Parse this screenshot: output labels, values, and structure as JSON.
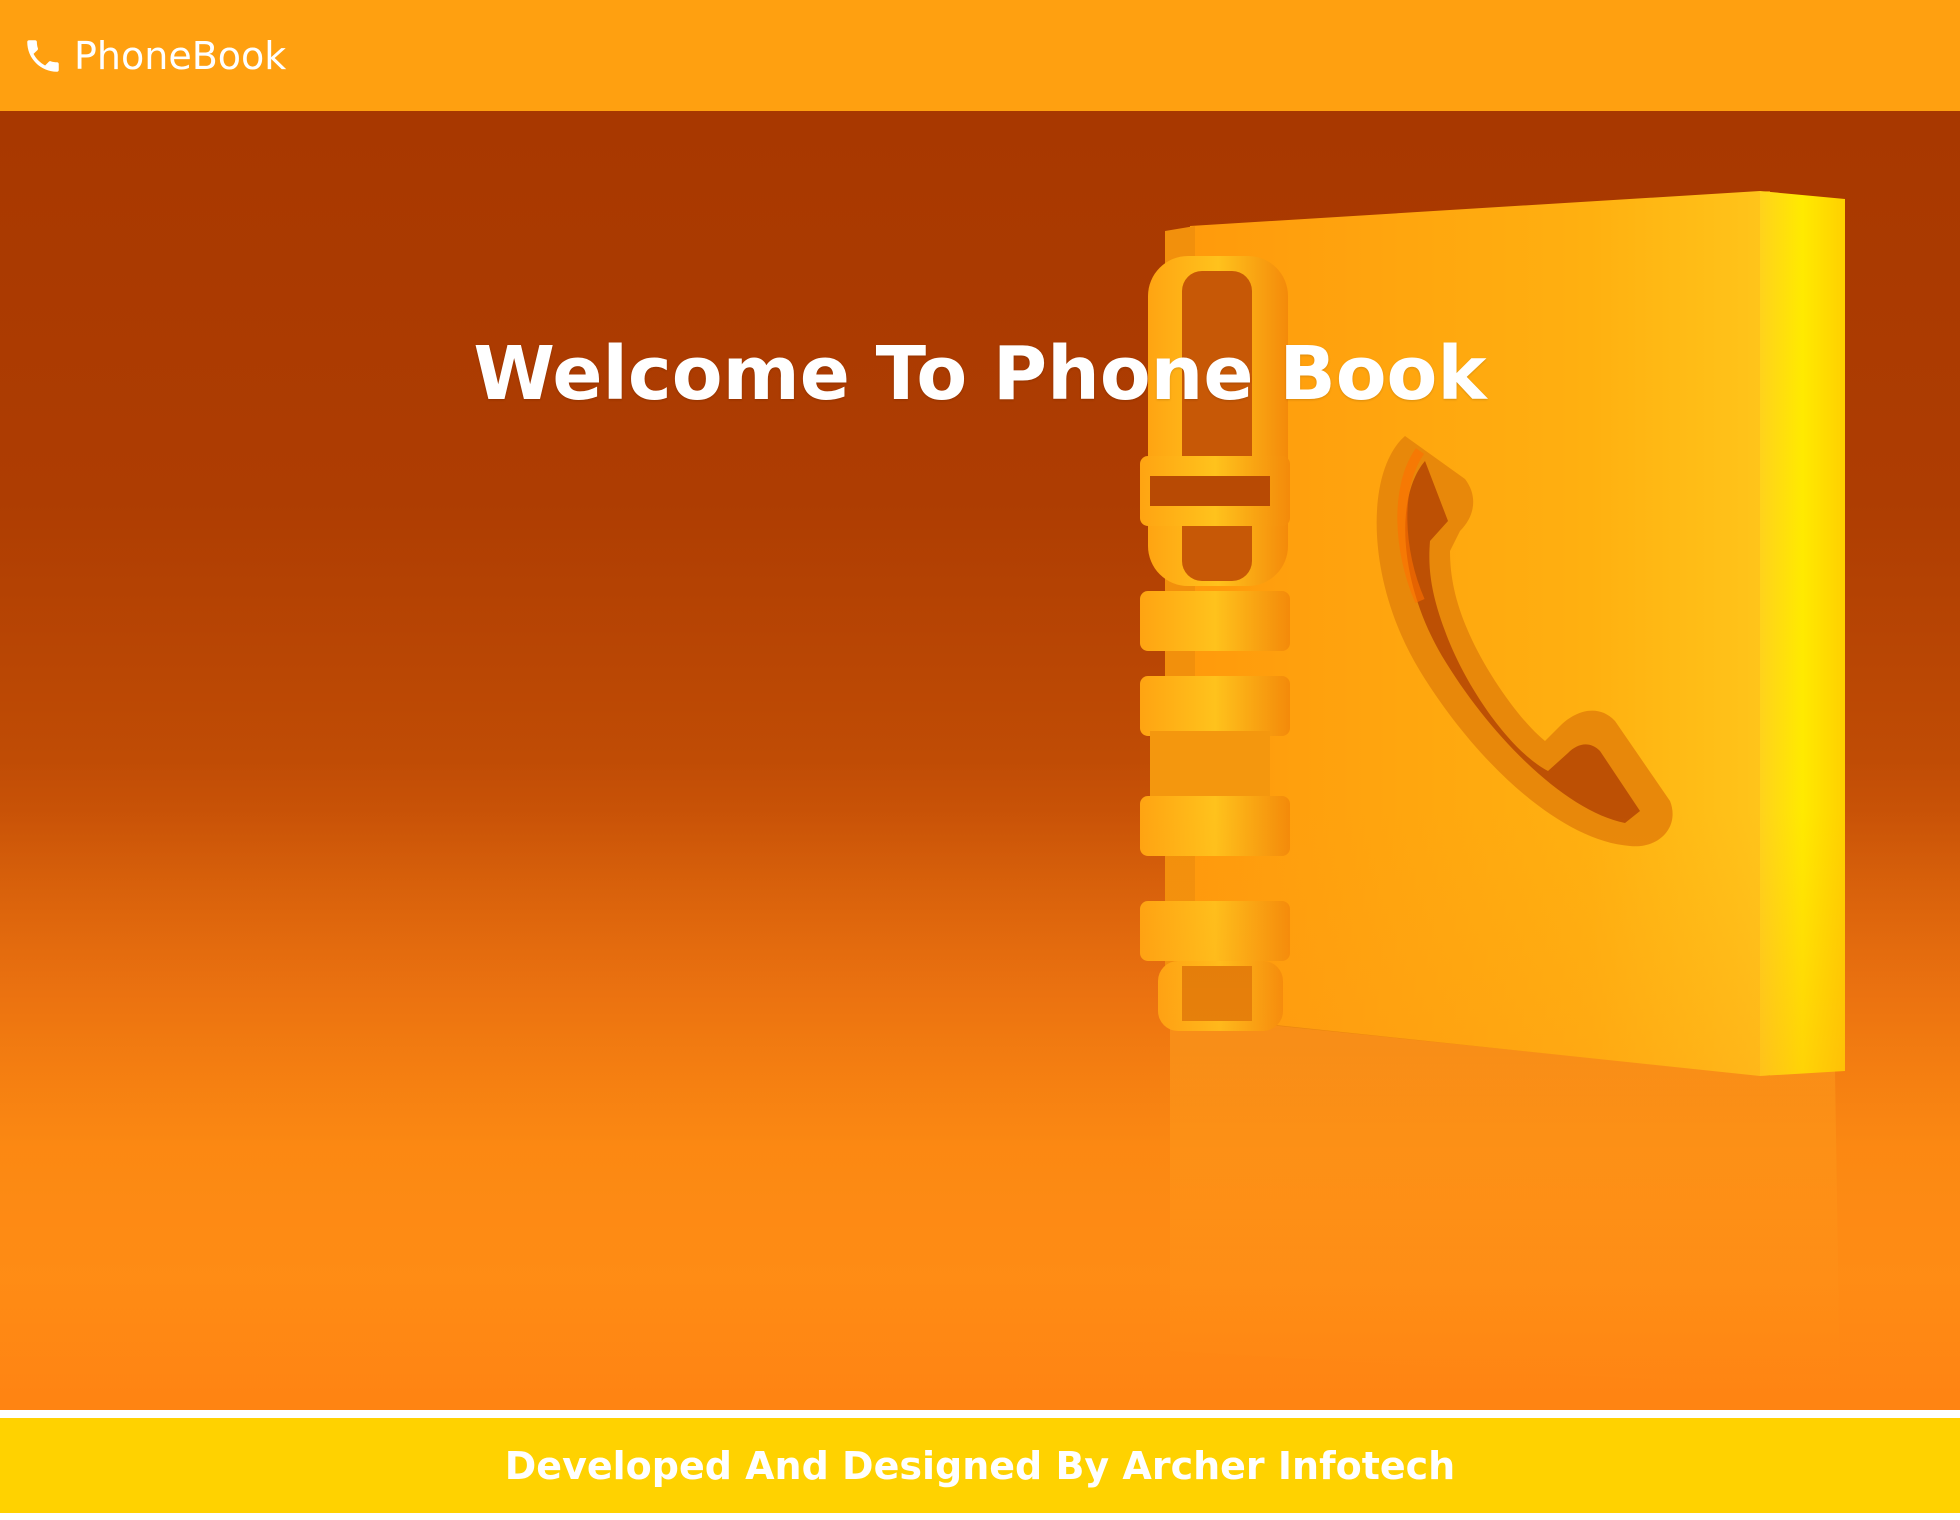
{
  "navbar": {
    "brand_label": "PhoneBook",
    "brand_icon": "phone-icon",
    "background_color": "#FFA010"
  },
  "hero": {
    "title": "Welcome To Phone Book",
    "image": "phonebook-illustration",
    "accent_color": "#FF8A14"
  },
  "footer": {
    "text": "Developed And Designed By Archer Infotech",
    "background_color": "#FFD200"
  }
}
